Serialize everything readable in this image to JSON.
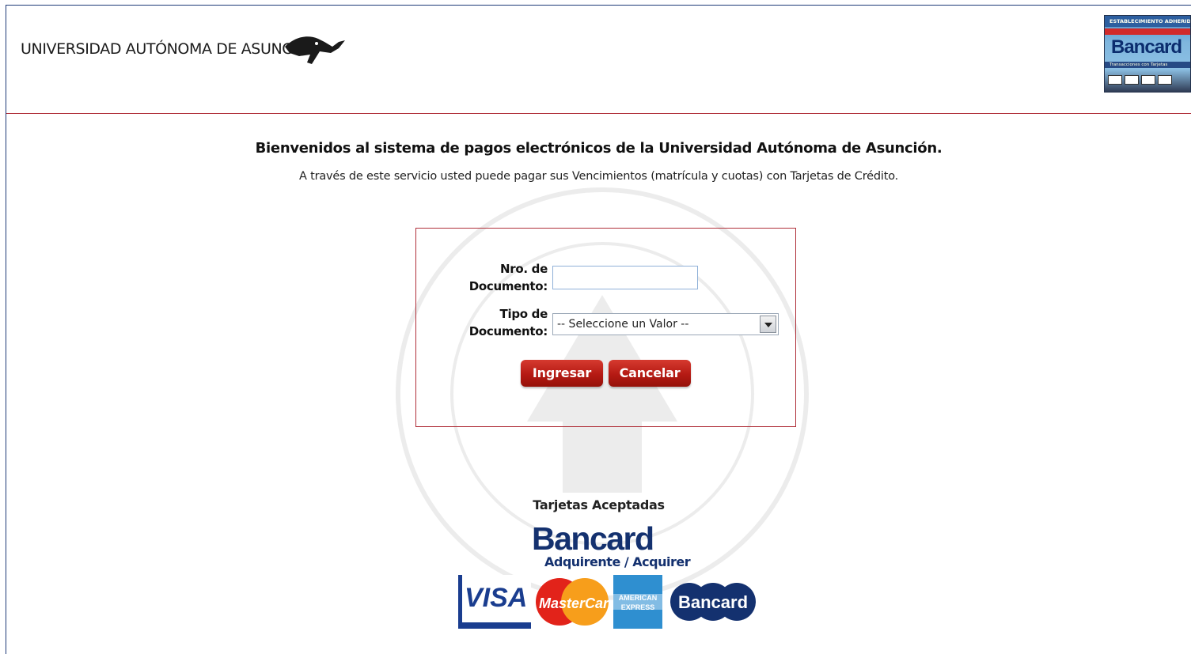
{
  "header": {
    "university_name": "UNIVERSIDAD AUTÓNOMA DE ASUNCIÓN",
    "badge": {
      "top": "ESTABLECIMIENTO ADHERIDO",
      "word": "Bancard",
      "sub": "Transacciones con Tarjetas"
    }
  },
  "welcome": {
    "title": "Bienvenidos al sistema de pagos electrónicos de la Universidad Autónoma de Asunción.",
    "subtitle": "A través de este servicio usted puede pagar sus Vencimientos (matrícula y cuotas) con Tarjetas de Crédito."
  },
  "form": {
    "doc_label_line1": "Nro. de",
    "doc_label_line2": "Documento:",
    "doc_value": "",
    "tipo_label_line1": "Tipo de",
    "tipo_label_line2": "Documento:",
    "tipo_selected": "-- Seleccione un Valor --",
    "ingresar_label": "Ingresar",
    "cancelar_label": "Cancelar"
  },
  "cards": {
    "title": "Tarjetas Aceptadas",
    "acquirer_name": "Bancard",
    "acquirer_tag": "Adquirente / Acquirer",
    "visa": "VISA",
    "mastercard": "MasterCard",
    "amex_line1": "AMERICAN",
    "amex_line2": "EXPRESS",
    "bancard_card": "Bancard"
  },
  "colors": {
    "accent_red": "#b0303a",
    "button_red": "#b51a14",
    "brand_blue": "#14316f"
  }
}
